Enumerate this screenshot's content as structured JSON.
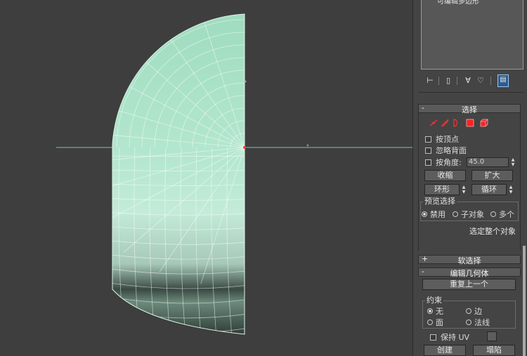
{
  "colors": {
    "viewport_bg": "#3e3e3e",
    "mesh_fill": "#a9e0c6",
    "wire": "#ffffff",
    "horizon": "#7ec7a2",
    "panel_bg": "#444444",
    "accent_red": "#ff2a2a"
  },
  "stack": {
    "partial_label": "可编辑多边形",
    "tools": [
      "pin-stack-icon",
      "show-end-result-icon",
      "make-unique-icon",
      "remove-modifier-icon",
      "configure-modifier-sets-icon"
    ]
  },
  "selection": {
    "header": "选择",
    "collapse_sign": "-",
    "level_icons": [
      "vertex-icon",
      "edge-icon",
      "border-icon",
      "polygon-icon",
      "element-icon"
    ],
    "by_vertex": "按顶点",
    "ignore_backfacing": "忽略背面",
    "by_angle": "按角度:",
    "angle_value": "45.0",
    "shrink": "收缩",
    "grow": "扩大",
    "ring": "环形",
    "loop": "循环",
    "preview_group": "预览选择",
    "preview_options": [
      "禁用",
      "子对象",
      "多个"
    ],
    "preview_selected": 0,
    "status": "选定整个对象"
  },
  "soft_selection": {
    "header": "软选择",
    "expand_sign": "+"
  },
  "edit_geometry": {
    "header": "编辑几何体",
    "collapse_sign": "-",
    "repeat_last": "重复上一个",
    "constraints_group": "约束",
    "constraints": [
      "无",
      "边",
      "面",
      "法线"
    ],
    "constraint_selected": 0,
    "preserve_uv": "保持 UV",
    "create": "创建",
    "collapse": "塌陷"
  }
}
